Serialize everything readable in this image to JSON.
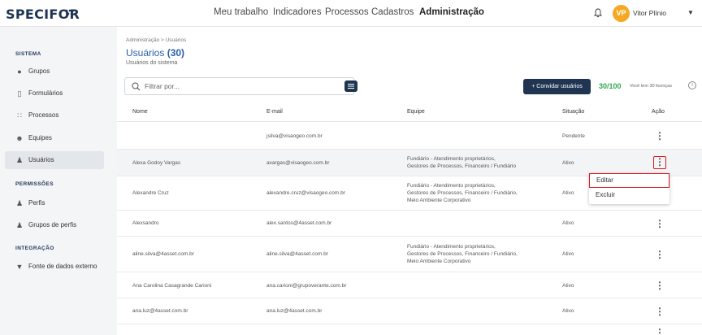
{
  "brand": {
    "logo_text": "SPECIFOR"
  },
  "topnav": {
    "items": [
      "Meu trabalho",
      "Indicadores",
      "Processos",
      "Cadastros",
      "Administração"
    ],
    "active_index": 4
  },
  "user": {
    "initials": "VP",
    "name": "Vitor Plínio",
    "avatar_color": "#f7a823"
  },
  "sidebar": {
    "sections": [
      {
        "title": "SISTEMA",
        "items": [
          {
            "label": "Grupos",
            "icon": "tag-icon"
          },
          {
            "label": "Formulários",
            "icon": "clipboard-icon"
          },
          {
            "label": "Processos",
            "icon": "process-icon"
          },
          {
            "label": "Equipes",
            "icon": "team-icon"
          },
          {
            "label": "Usuários",
            "icon": "user-icon",
            "active": true
          }
        ]
      },
      {
        "title": "PERMISSÕES",
        "items": [
          {
            "label": "Perfis",
            "icon": "profile-icon"
          },
          {
            "label": "Grupos de perfis",
            "icon": "profile-group-icon"
          }
        ]
      },
      {
        "title": "INTEGRAÇÃO",
        "items": [
          {
            "label": "Fonte de dados externo",
            "icon": "plug-icon"
          }
        ]
      }
    ]
  },
  "page": {
    "breadcrumb": "Administração  >  Usuários",
    "title": "Usuários",
    "title_count": "(30)",
    "subtitle": "Usuários do sistema"
  },
  "toolbar": {
    "search_placeholder": "Filtrar por...",
    "invite_label": "+ Convidar usuários",
    "license_count": "30/100",
    "license_note": "Você tem 30 licenças"
  },
  "table": {
    "columns": [
      "Nome",
      "E-mail",
      "Equipe",
      "Situação",
      "Ação"
    ],
    "rows": [
      {
        "name": "",
        "email": "jsilva@visaogeo.com.br",
        "team": "",
        "status": "Pendente"
      },
      {
        "name": "Alexa Godoy Vargas",
        "email": "avargas@visaogeo.com.br",
        "team": "Fundiário - Atendimento proprietários,\nGestores de Processos, Financeiro / Fundiário",
        "status": "Ativo"
      },
      {
        "name": "Alexandre Cruz",
        "email": "alexandre.cruz@visaogeo.com.br",
        "team": "Fundiário - Atendimento proprietários,\nGestores de Processos, Financeiro / Fundiário,\nMeio Ambiente Corporativo",
        "status": "Ativo"
      },
      {
        "name": "Alexsandro",
        "email": "alex.santos@4asset.com.br",
        "team": "",
        "status": "Ativo"
      },
      {
        "name": "aline.silva@4asset.com.br",
        "email": "aline.silva@4asset.com.br",
        "team": "Fundiário - Atendimento proprietários,\nGestores de Processos, Financeiro / Fundiário,\nMeio Ambiente Corporativo",
        "status": "Ativo"
      },
      {
        "name": "Ana Carolina Casagrande Carioni",
        "email": "ana.carioni@grupoverante.com.br",
        "team": "",
        "status": "Ativo"
      },
      {
        "name": "ana.luz@4asset.com.br",
        "email": "ana.luz@4asset.com.br",
        "team": "",
        "status": "Ativo"
      }
    ]
  },
  "action_menu": {
    "items": [
      "Editar",
      "Excluir"
    ]
  },
  "colors": {
    "brand": "#1f3552",
    "accent": "#2a5dac",
    "green": "#2fa84f",
    "highlight": "#d71920"
  }
}
